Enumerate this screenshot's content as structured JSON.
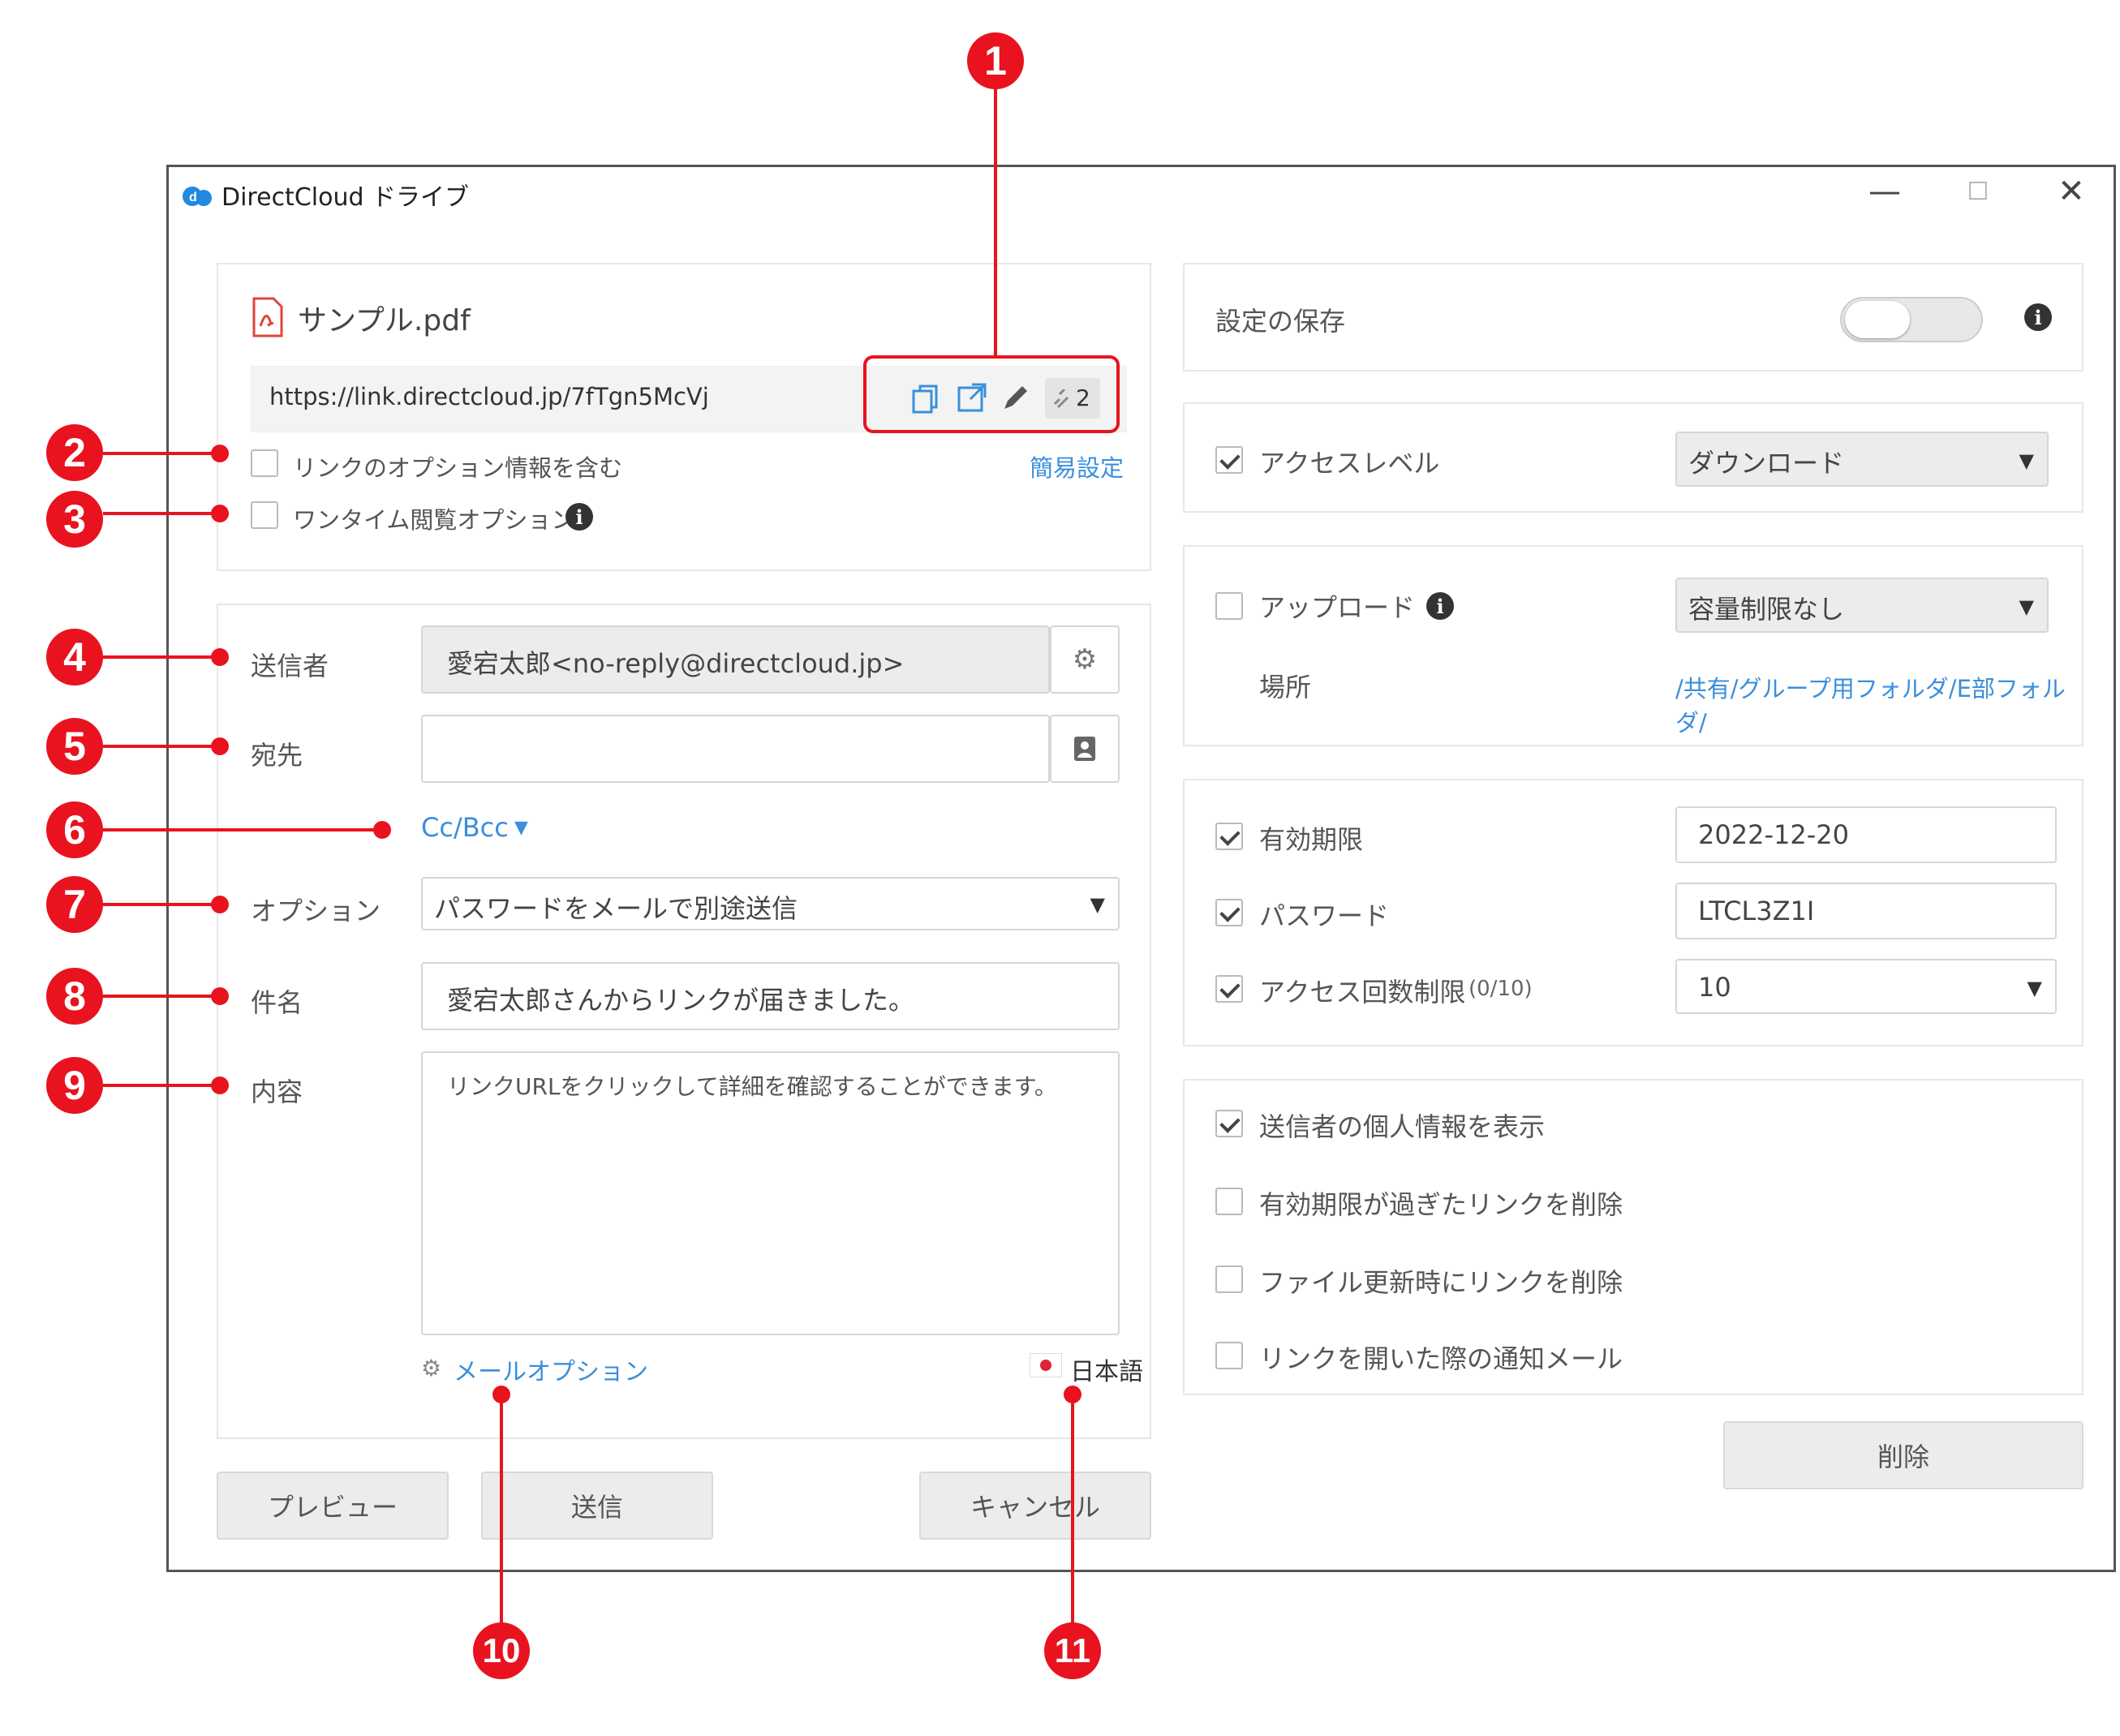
{
  "window": {
    "title": "DirectCloud ドライブ",
    "minimize": "—",
    "maximize": "☐",
    "close": "✕"
  },
  "file": {
    "name": "サンプル.pdf",
    "url": "https://link.directcloud.jp/7fTgn5McVj",
    "link_count": "2",
    "include_link_options_label": "リンクのオプション情報を含む",
    "easy_settings_label": "簡易設定",
    "one_time_view_label": "ワンタイム閲覧オプション"
  },
  "mail": {
    "sender_label": "送信者",
    "sender_value": "愛宕太郎<no-reply@directcloud.jp>",
    "recipient_label": "宛先",
    "recipient_value": "",
    "cc_bcc_label": "Cc/Bcc",
    "option_label": "オプション",
    "option_value": "パスワードをメールで別途送信",
    "subject_label": "件名",
    "subject_value": "愛宕太郎さんからリンクが届きました。",
    "content_label": "内容",
    "content_value": "リンクURLをクリックして詳細を確認することができます。",
    "mail_options_label": "メールオプション",
    "language_label": "日本語"
  },
  "buttons": {
    "preview": "プレビュー",
    "send": "送信",
    "cancel": "キャンセル",
    "delete": "削除"
  },
  "settings": {
    "save_settings_label": "設定の保存",
    "save_settings_on": false,
    "access_level_label": "アクセスレベル",
    "access_level_checked": true,
    "access_level_value": "ダウンロード",
    "upload_label": "アップロード",
    "upload_checked": false,
    "upload_value": "容量制限なし",
    "location_label": "場所",
    "location_value": "/共有/グループ用フォルダ/E部フォルダ/",
    "expiry_label": "有効期限",
    "expiry_checked": true,
    "expiry_value": "2022-12-20",
    "password_label": "パスワード",
    "password_checked": true,
    "password_value": "LTCL3Z1I",
    "access_count_label": "アクセス回数制限",
    "access_count_status": "(0/10)",
    "access_count_checked": true,
    "access_count_value": "10",
    "show_sender_info_label": "送信者の個人情報を表示",
    "show_sender_info_checked": true,
    "delete_expired_label": "有効期限が過ぎたリンクを削除",
    "delete_expired_checked": false,
    "delete_on_update_label": "ファイル更新時にリンクを削除",
    "delete_on_update_checked": false,
    "open_notification_label": "リンクを開いた際の通知メール",
    "open_notification_checked": false
  },
  "callouts": [
    "1",
    "2",
    "3",
    "4",
    "5",
    "6",
    "7",
    "8",
    "9",
    "10",
    "11"
  ],
  "colors": {
    "callout": "#e8131f",
    "link": "#3a8fdc",
    "pdf_icon": "#e0453a"
  }
}
